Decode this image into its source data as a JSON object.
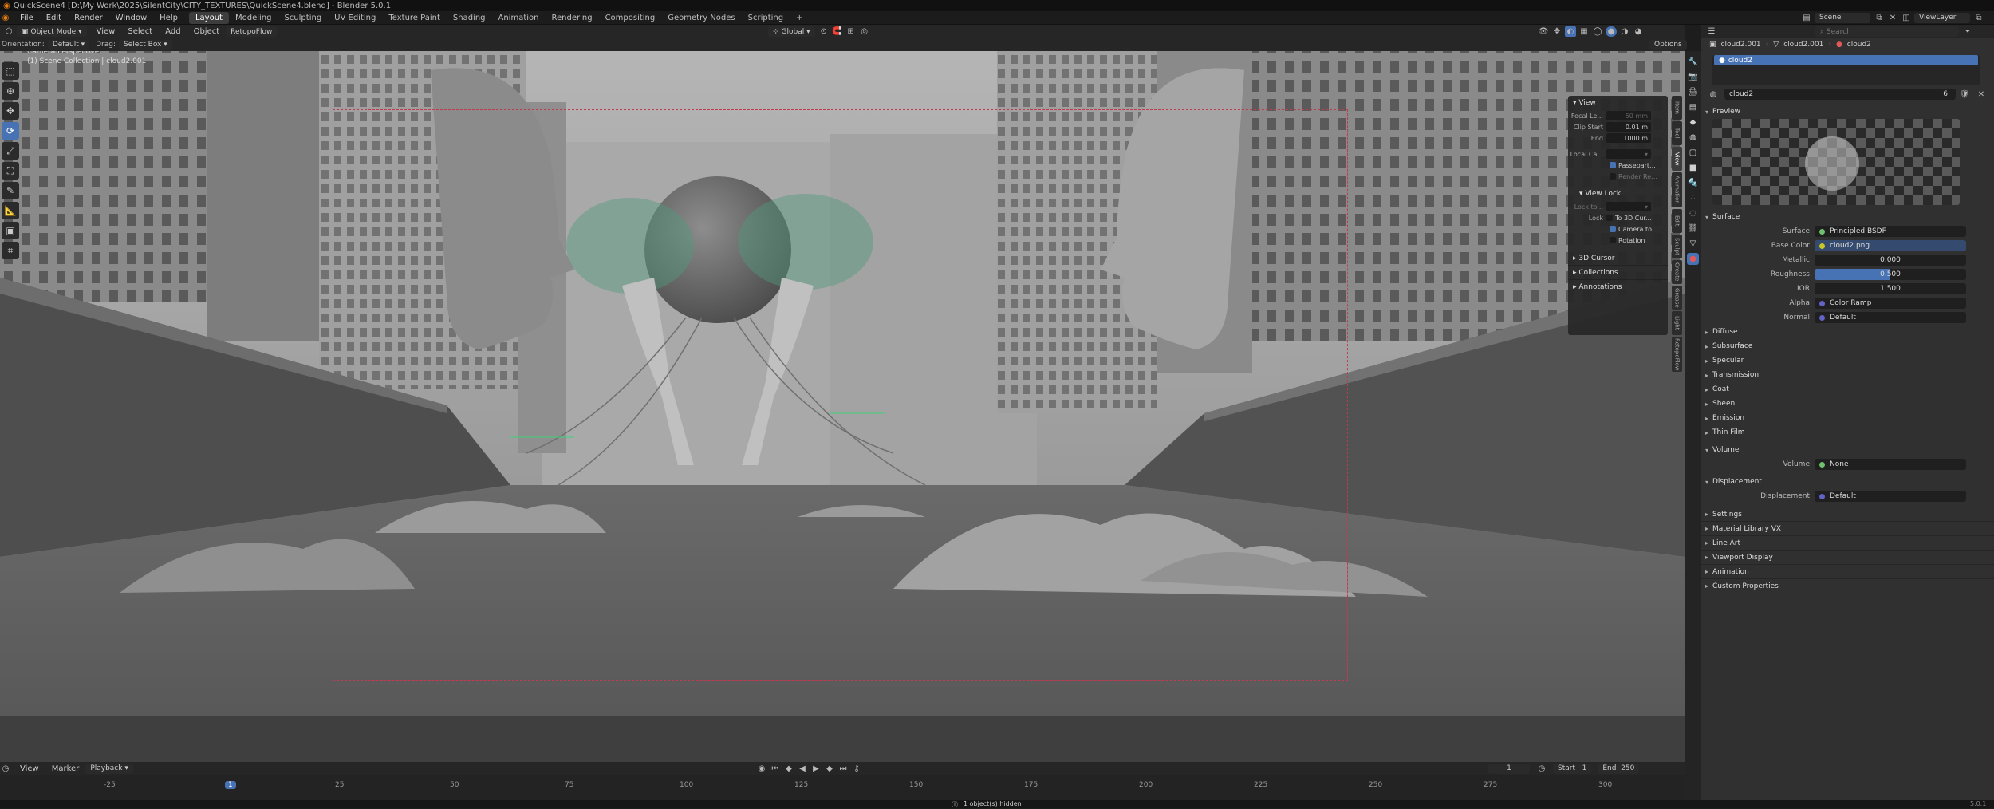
{
  "title": "QuickScene4 [D:\\My Work\\2025\\SilentCity\\CITY_TEXTURES\\QuickScene4.blend] - Blender 5.0.1",
  "menu": [
    "File",
    "Edit",
    "Render",
    "Window",
    "Help"
  ],
  "workspaces": [
    "Layout",
    "Modeling",
    "Sculpting",
    "UV Editing",
    "Texture Paint",
    "Shading",
    "Animation",
    "Rendering",
    "Compositing",
    "Geometry Nodes",
    "Scripting"
  ],
  "active_workspace": "Layout",
  "scene": {
    "name": "Scene",
    "view_layer": "ViewLayer"
  },
  "viewport_header": {
    "mode": "Object Mode",
    "menus": [
      "View",
      "Select",
      "Add",
      "Object"
    ],
    "retopo": "RetopoFlow",
    "transform": "Global",
    "options": "Options"
  },
  "tool_header": {
    "orientation_label": "Orientation:",
    "orientation": "Default",
    "drag_label": "Drag:",
    "drag": "Select Box"
  },
  "overlay_text": {
    "line1": "Camera Perspective",
    "line2": "(1) Scene Collection | cloud2.001"
  },
  "n_panel": {
    "view_section": "View",
    "focal_label": "Focal Le...",
    "focal_value": "50 mm",
    "clip_start_label": "Clip Start",
    "clip_start": "0.01 m",
    "end_label": "End",
    "end": "1000 m",
    "local_cam_label": "Local Ca...",
    "passepartout": "Passepart...",
    "render_region": "Render Re...",
    "view_lock_section": "View Lock",
    "lock_to_label": "Lock to...",
    "lock_label": "Lock",
    "to_3d_cursor": "To 3D Cur...",
    "camera_to": "Camera to ...",
    "rotation": "Rotation",
    "sections": [
      "3D Cursor",
      "Collections",
      "Annotations"
    ],
    "tabs": [
      "Item",
      "Tool",
      "View",
      "Animation",
      "Edit",
      "Sculpt",
      "Create",
      "Grease",
      "Light",
      "RetopoFlow"
    ]
  },
  "properties": {
    "breadcrumb": [
      "cloud2.001",
      "cloud2.001",
      "cloud2"
    ],
    "slot": "cloud2",
    "material": "cloud2",
    "users": "6",
    "preview_section": "Preview",
    "surface_section": "Surface",
    "surface_label": "Surface",
    "surface": "Principled BSDF",
    "base_color_label": "Base Color",
    "base_color": "cloud2.png",
    "metallic_label": "Metallic",
    "metallic": "0.000",
    "roughness_label": "Roughness",
    "roughness": "0.500",
    "roughness_fraction": 0.5,
    "ior_label": "IOR",
    "ior": "1.500",
    "alpha_label": "Alpha",
    "alpha": "Color Ramp",
    "normal_label": "Normal",
    "normal": "Default",
    "subpanels": [
      "Diffuse",
      "Subsurface",
      "Specular",
      "Transmission",
      "Coat",
      "Sheen",
      "Emission",
      "Thin Film"
    ],
    "volume_section": "Volume",
    "volume_label": "Volume",
    "volume": "None",
    "displacement_section": "Displacement",
    "displacement_label": "Displacement",
    "displacement": "Default",
    "bottom_sections": [
      "Settings",
      "Material Library VX",
      "Line Art",
      "Viewport Display",
      "Animation",
      "Custom Properties"
    ]
  },
  "timeline": {
    "menus": [
      "View",
      "Marker",
      "Playback"
    ],
    "current_frame": "1",
    "start_label": "Start",
    "start": "1",
    "end_label": "End",
    "end": "250",
    "ticks": [
      "-25",
      "1",
      "25",
      "50",
      "75",
      "100",
      "125",
      "150",
      "175",
      "200",
      "225",
      "250",
      "275",
      "300"
    ]
  },
  "status": {
    "message": "1 object(s) hidden",
    "version": "5.0.1"
  },
  "colors": {
    "accent": "#4772b3",
    "camera_frame": "#c23a52",
    "socket_yellow": "#c7c729",
    "socket_purple": "#6363c7"
  }
}
